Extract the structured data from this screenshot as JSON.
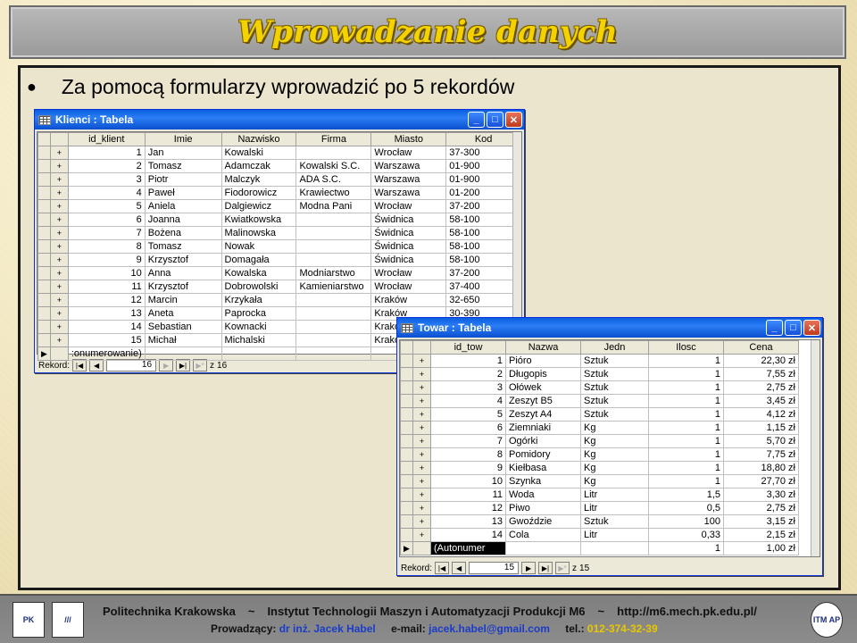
{
  "slide": {
    "title": "Wprowadzanie danych",
    "bullet": "Za pomocą formularzy wprowadzić po 5 rekordów"
  },
  "klienci": {
    "window_title": "Klienci : Tabela",
    "columns": [
      "id_klient",
      "Imie",
      "Nazwisko",
      "Firma",
      "Miasto",
      "Kod"
    ],
    "rows": [
      [
        "1",
        "Jan",
        "Kowalski",
        "",
        "Wrocław",
        "37-300"
      ],
      [
        "2",
        "Tomasz",
        "Adamczak",
        "Kowalski S.C.",
        "Warszawa",
        "01-900"
      ],
      [
        "3",
        "Piotr",
        "Malczyk",
        "ADA S.C.",
        "Warszawa",
        "01-900"
      ],
      [
        "4",
        "Paweł",
        "Fiodorowicz",
        "Krawiectwo",
        "Warszawa",
        "01-200"
      ],
      [
        "5",
        "Aniela",
        "Dalgiewicz",
        "Modna Pani",
        "Wrocław",
        "37-200"
      ],
      [
        "6",
        "Joanna",
        "Kwiatkowska",
        "",
        "Świdnica",
        "58-100"
      ],
      [
        "7",
        "Bożena",
        "Malinowska",
        "",
        "Świdnica",
        "58-100"
      ],
      [
        "8",
        "Tomasz",
        "Nowak",
        "",
        "Świdnica",
        "58-100"
      ],
      [
        "9",
        "Krzysztof",
        "Domagała",
        "",
        "Świdnica",
        "58-100"
      ],
      [
        "10",
        "Anna",
        "Kowalska",
        "Modniarstwo",
        "Wrocław",
        "37-200"
      ],
      [
        "11",
        "Krzysztof",
        "Dobrowolski",
        "Kamieniarstwo",
        "Wrocław",
        "37-400"
      ],
      [
        "12",
        "Marcin",
        "Krzykała",
        "",
        "Kraków",
        "32-650"
      ],
      [
        "13",
        "Aneta",
        "Paprocka",
        "",
        "Kraków",
        "30-390"
      ],
      [
        "14",
        "Sebastian",
        "Kownacki",
        "",
        "Krakó",
        ""
      ],
      [
        "15",
        "Michał",
        "Michalski",
        "",
        "Krakó",
        ""
      ]
    ],
    "new_row_text": ":onumerowanie)",
    "nav_label": "Rekord:",
    "current_record": "16",
    "of_label": "z",
    "total_records": "16"
  },
  "towar": {
    "window_title": "Towar : Tabela",
    "columns": [
      "id_tow",
      "Nazwa",
      "Jedn",
      "Ilosc",
      "Cena"
    ],
    "rows": [
      [
        "1",
        "Pióro",
        "Sztuk",
        "1",
        "22,30 zł"
      ],
      [
        "2",
        "Długopis",
        "Sztuk",
        "1",
        "7,55 zł"
      ],
      [
        "3",
        "Ołówek",
        "Sztuk",
        "1",
        "2,75 zł"
      ],
      [
        "4",
        "Zeszyt B5",
        "Sztuk",
        "1",
        "3,45 zł"
      ],
      [
        "5",
        "Zeszyt A4",
        "Sztuk",
        "1",
        "4,12 zł"
      ],
      [
        "6",
        "Ziemniaki",
        "Kg",
        "1",
        "1,15 zł"
      ],
      [
        "7",
        "Ogórki",
        "Kg",
        "1",
        "5,70 zł"
      ],
      [
        "8",
        "Pomidory",
        "Kg",
        "1",
        "7,75 zł"
      ],
      [
        "9",
        "Kiełbasa",
        "Kg",
        "1",
        "18,80 zł"
      ],
      [
        "10",
        "Szynka",
        "Kg",
        "1",
        "27,70 zł"
      ],
      [
        "11",
        "Woda",
        "Litr",
        "1,5",
        "3,30 zł"
      ],
      [
        "12",
        "Piwo",
        "Litr",
        "0,5",
        "2,75 zł"
      ],
      [
        "13",
        "Gwoździe",
        "Sztuk",
        "100",
        "3,15 zł"
      ],
      [
        "14",
        "Cola",
        "Litr",
        "0,33",
        "2,15 zł"
      ]
    ],
    "new_row": [
      "(Autonumer",
      "",
      "",
      "1",
      "1,00 zł"
    ],
    "nav_label": "Rekord:",
    "current_record": "15",
    "of_label": "z",
    "total_records": "15"
  },
  "footer": {
    "line1": [
      "Politechnika Krakowska",
      "~",
      "Instytut Technologii Maszyn i Automatyzacji Produkcji M6",
      "~",
      "http://m6.mech.pk.edu.pl/"
    ],
    "lecturer_label": "Prowadzący:",
    "lecturer": "dr inż. Jacek Habel",
    "email_label": "e-mail:",
    "email": "jacek.habel@gmail.com",
    "phone_label": "tel.:",
    "phone": "012-374-32-39",
    "logo_left": "PK",
    "logo_mid": "///",
    "logo_right": "ITM AP"
  },
  "colors": {
    "title_yellow": "#f4d200",
    "window_blue": "#0a5fe0",
    "footer_blue": "#1a3cc8"
  }
}
